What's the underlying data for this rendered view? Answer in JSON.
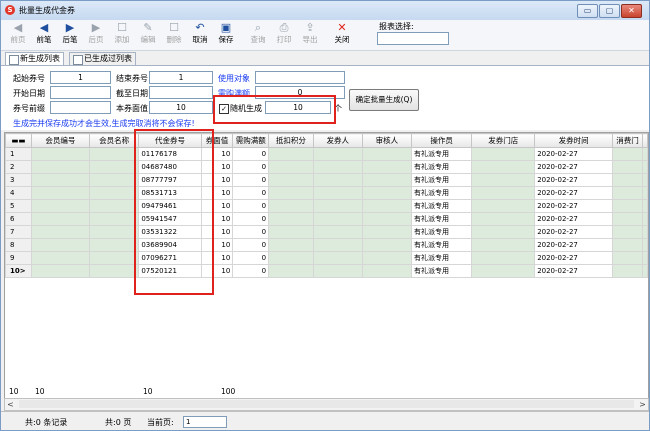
{
  "window": {
    "title": "批量生成代金券"
  },
  "toolbar": {
    "buttons": [
      {
        "label": "前页",
        "icon": "◀",
        "enabled": false
      },
      {
        "label": "前笔",
        "icon": "◀",
        "enabled": true
      },
      {
        "label": "后笔",
        "icon": "▶",
        "enabled": true
      },
      {
        "label": "后页",
        "icon": "▶",
        "enabled": false
      },
      {
        "label": "添加",
        "icon": "☐",
        "enabled": false
      },
      {
        "label": "编辑",
        "icon": "✎",
        "enabled": false
      },
      {
        "label": "删除",
        "icon": "☐",
        "enabled": false
      },
      {
        "label": "取消",
        "icon": "↶",
        "enabled": true
      },
      {
        "label": "保存",
        "icon": "▣",
        "enabled": true
      },
      {
        "label": "查询",
        "icon": "⌕",
        "enabled": false
      },
      {
        "label": "打印",
        "icon": "⎙",
        "enabled": false
      },
      {
        "label": "导出",
        "icon": "⇪",
        "enabled": false
      },
      {
        "label": "关闭",
        "icon": "✕",
        "enabled": true
      }
    ],
    "report_label": "报表选择:"
  },
  "tabs": [
    {
      "label": "新生成列表"
    },
    {
      "label": "已生成过列表"
    }
  ],
  "form": {
    "start_no_label": "起始券号",
    "start_no_value": "1",
    "end_no_label": "结束券号",
    "end_no_value": "1",
    "use_target_label": "使用对象",
    "open_date_label": "开始日期",
    "close_date_label": "截至日期",
    "min_purchase_label": "需购满额",
    "min_purchase_value": "0",
    "prefix_label": "券号前缀",
    "face_value_label": "本券面值",
    "face_value_value": "10",
    "random_label": "随机生成",
    "random_value": "10",
    "random_unit": "个",
    "batch_button": "确定批量生成(Q)",
    "hint": "生成完并保存成功才会生效,生成完取消将不会保存!"
  },
  "grid": {
    "headers": [
      "会员编号",
      "会员名称",
      "代金券号",
      "券面值",
      "需购满额",
      "抵扣积分",
      "发券人",
      "审核人",
      "操作员",
      "发券门店",
      "发券时间",
      "消费门"
    ],
    "rows": [
      {
        "rn": "1",
        "coupon": "01176178",
        "value": "10",
        "min": "0",
        "operator": "有礼派专用",
        "time": "2020-02-27"
      },
      {
        "rn": "2",
        "coupon": "04687480",
        "value": "10",
        "min": "0",
        "operator": "有礼派专用",
        "time": "2020-02-27"
      },
      {
        "rn": "3",
        "coupon": "08777797",
        "value": "10",
        "min": "0",
        "operator": "有礼派专用",
        "time": "2020-02-27"
      },
      {
        "rn": "4",
        "coupon": "08531713",
        "value": "10",
        "min": "0",
        "operator": "有礼派专用",
        "time": "2020-02-27"
      },
      {
        "rn": "5",
        "coupon": "09479461",
        "value": "10",
        "min": "0",
        "operator": "有礼派专用",
        "time": "2020-02-27"
      },
      {
        "rn": "6",
        "coupon": "05941547",
        "value": "10",
        "min": "0",
        "operator": "有礼派专用",
        "time": "2020-02-27"
      },
      {
        "rn": "7",
        "coupon": "03531322",
        "value": "10",
        "min": "0",
        "operator": "有礼派专用",
        "time": "2020-02-27"
      },
      {
        "rn": "8",
        "coupon": "03689904",
        "value": "10",
        "min": "0",
        "operator": "有礼派专用",
        "time": "2020-02-27"
      },
      {
        "rn": "9",
        "coupon": "07096271",
        "value": "10",
        "min": "0",
        "operator": "有礼派专用",
        "time": "2020-02-27"
      },
      {
        "rn": "10>",
        "coupon": "07520121",
        "value": "10",
        "min": "0",
        "operator": "有礼派专用",
        "time": "2020-02-27"
      }
    ],
    "footer": {
      "count": "10",
      "member_no": "10",
      "coupon": "10",
      "total": "100"
    }
  },
  "status": {
    "records": "共:0 条记录",
    "pages": "共:0 页",
    "current_page_label": "当前页:",
    "current_page": "1"
  },
  "colors": {
    "accent_red": "#e0221c",
    "link_blue": "#1a3cf0",
    "row_green": "#dcebdc"
  }
}
